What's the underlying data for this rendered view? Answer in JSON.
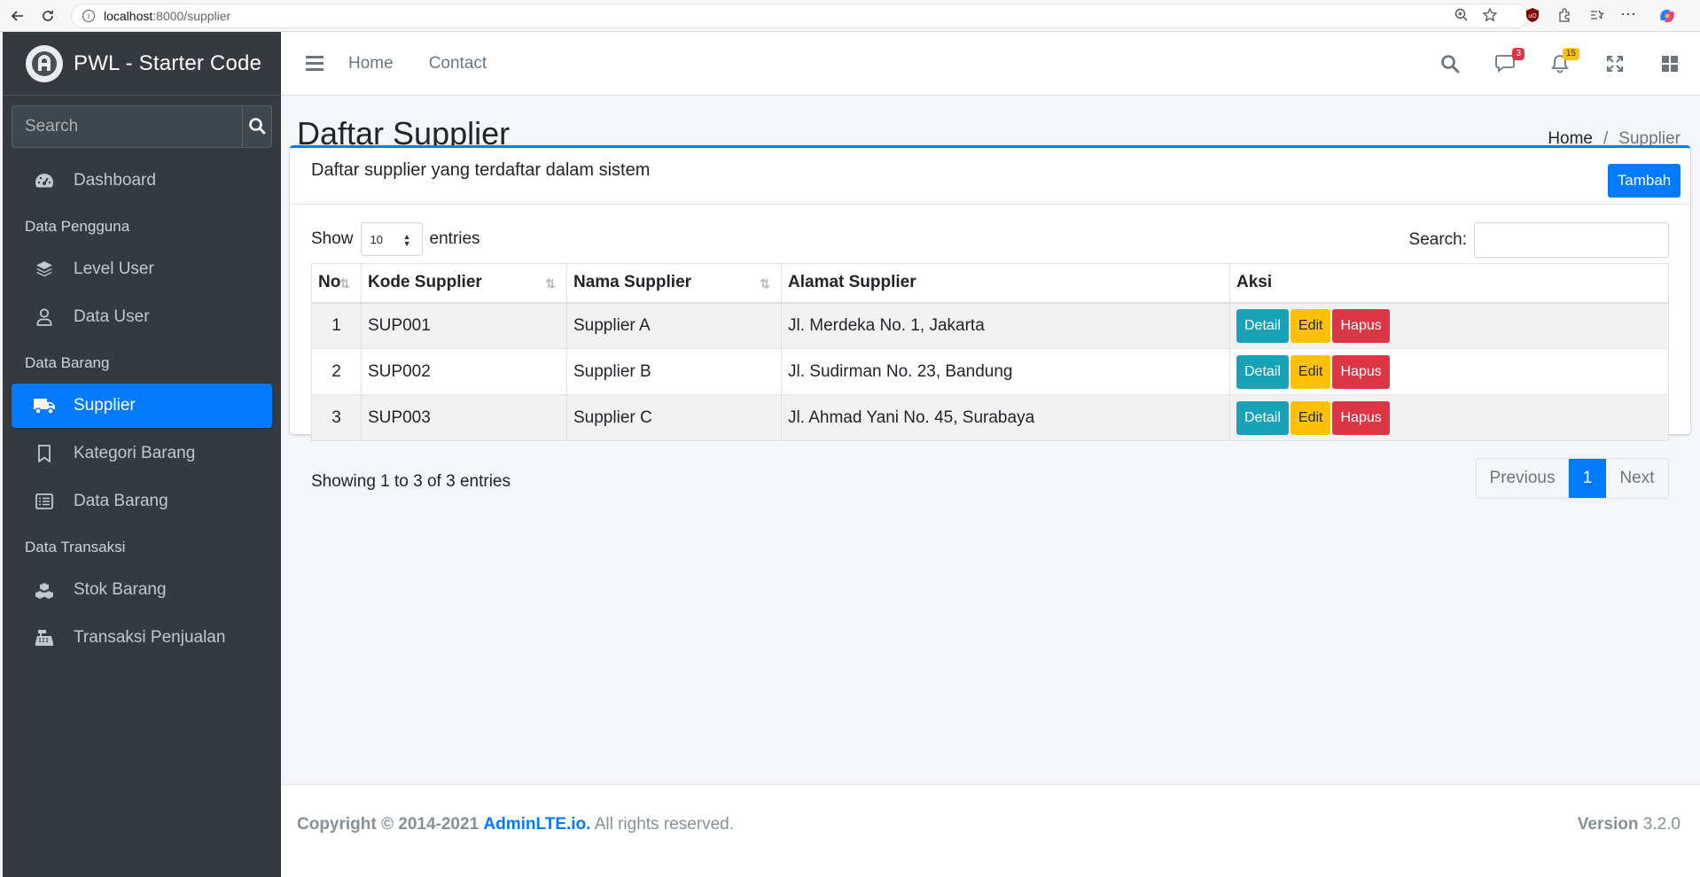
{
  "browser": {
    "url_host": "localhost",
    "url_path": ":8000/supplier"
  },
  "brand": {
    "title": "PWL - Starter Code"
  },
  "sidebar": {
    "search_placeholder": "Search",
    "items": [
      {
        "type": "link",
        "label": "Dashboard",
        "icon": "tachometer-icon"
      },
      {
        "type": "header",
        "label": "Data Pengguna"
      },
      {
        "type": "link",
        "label": "Level User",
        "icon": "layers-icon"
      },
      {
        "type": "link",
        "label": "Data User",
        "icon": "user-icon"
      },
      {
        "type": "header",
        "label": "Data Barang"
      },
      {
        "type": "link",
        "label": "Supplier",
        "icon": "truck-icon",
        "active": true
      },
      {
        "type": "link",
        "label": "Kategori Barang",
        "icon": "bookmark-icon"
      },
      {
        "type": "link",
        "label": "Data Barang",
        "icon": "list-icon"
      },
      {
        "type": "header",
        "label": "Data Transaksi"
      },
      {
        "type": "link",
        "label": "Stok Barang",
        "icon": "cubes-icon"
      },
      {
        "type": "link",
        "label": "Transaksi Penjualan",
        "icon": "cash-register-icon"
      }
    ]
  },
  "topnav": {
    "links": [
      "Home",
      "Contact"
    ],
    "messages_badge": "3",
    "notifications_badge": "15"
  },
  "header": {
    "title": "Daftar Supplier",
    "breadcrumb_home": "Home",
    "breadcrumb_sep": "/",
    "breadcrumb_current": "Supplier"
  },
  "card": {
    "title": "Daftar supplier yang terdaftar dalam sistem",
    "add_label": "Tambah",
    "show_label": "Show",
    "entries_value": "10",
    "entries_label": "entries",
    "search_label": "Search:",
    "columns": [
      "No",
      "Kode Supplier",
      "Nama Supplier",
      "Alamat Supplier",
      "Aksi"
    ],
    "rows": [
      {
        "no": "1",
        "kode": "SUP001",
        "nama": "Supplier A",
        "alamat": "Jl. Merdeka No. 1, Jakarta"
      },
      {
        "no": "2",
        "kode": "SUP002",
        "nama": "Supplier B",
        "alamat": "Jl. Sudirman No. 23, Bandung"
      },
      {
        "no": "3",
        "kode": "SUP003",
        "nama": "Supplier C",
        "alamat": "Jl. Ahmad Yani No. 45, Surabaya"
      }
    ],
    "actions": {
      "detail": "Detail",
      "edit": "Edit",
      "hapus": "Hapus"
    },
    "info": "Showing 1 to 3 of 3 entries",
    "pager": {
      "prev": "Previous",
      "current": "1",
      "next": "Next"
    }
  },
  "footer": {
    "copyright": "Copyright © 2014-2021",
    "link": "AdminLTE.io.",
    "rights": "All rights reserved.",
    "version_label": "Version",
    "version": "3.2.0"
  },
  "colors": {
    "primary": "#007bff",
    "sidebar": "#343a40",
    "info": "#17a2b8",
    "warning": "#ffc107",
    "danger": "#dc3545"
  }
}
